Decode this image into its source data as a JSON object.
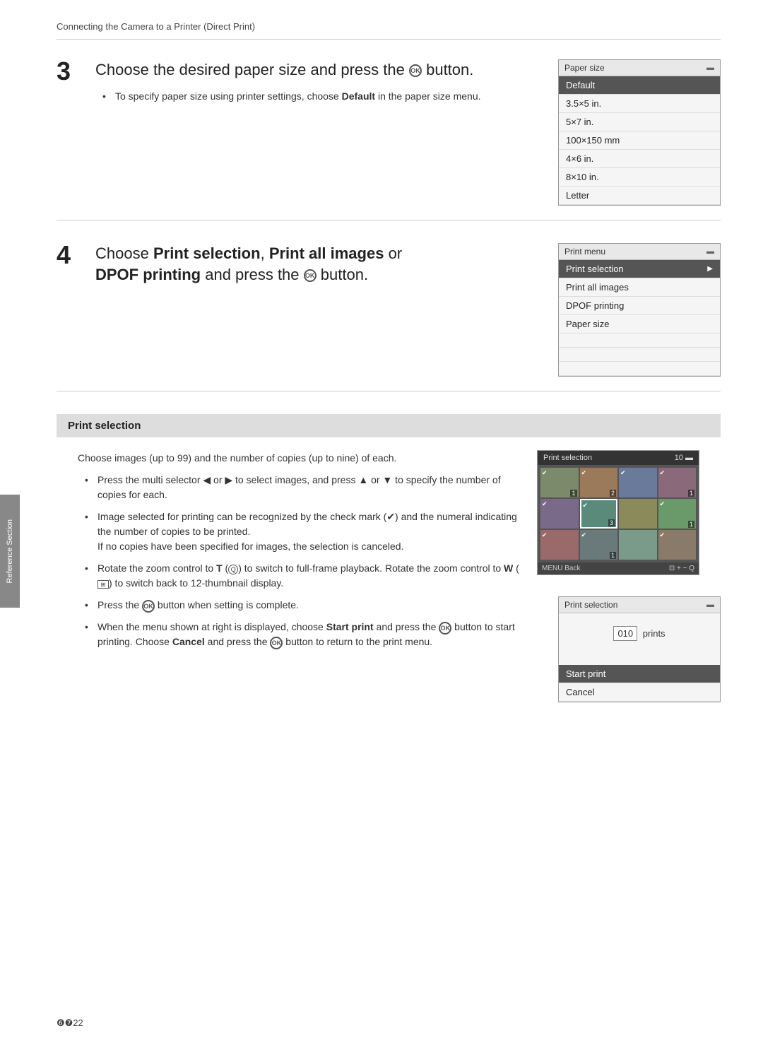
{
  "breadcrumb": "Connecting the Camera to a Printer (Direct Print)",
  "step3": {
    "number": "3",
    "title_part1": "Choose the desired paper size and press the",
    "title_part2": "button.",
    "bullet": "To specify paper size using printer settings, choose",
    "bullet_bold": "Default",
    "bullet_end": "in the paper size menu.",
    "screen": {
      "header": "Paper size",
      "items": [
        "Default",
        "3.5×5 in.",
        "5×7 in.",
        "100×150 mm",
        "4×6 in.",
        "8×10 in.",
        "Letter"
      ]
    }
  },
  "step4": {
    "number": "4",
    "title_part1": "Choose",
    "print_selection": "Print selection",
    "comma": ",",
    "print_all": "Print all images",
    "or": "or",
    "dpof": "DPOF printing",
    "title_part2": "and press the",
    "title_part3": "button.",
    "screen": {
      "header": "Print menu",
      "items": [
        "Print selection",
        "Print all images",
        "DPOF printing",
        "Paper size"
      ]
    }
  },
  "print_selection_section": {
    "header": "Print selection",
    "intro": "Choose images (up to 99) and the number of copies (up to nine) of each.",
    "bullets": [
      "Press the multi selector ◀ or ▶ to select images, and press ▲ or ▼ to specify the number of copies for each.",
      "Image selected for printing can be recognized by the check mark (✔) and the numeral indicating the number of copies to be printed.",
      "If no copies have been specified for images, the selection is canceled.",
      "Rotate the zoom control to T (Q) to switch to full-frame playback. Rotate the zoom control to W (⊡) to switch back to 12-thumbnail display.",
      "Press the OK button when setting is complete.",
      "When the menu shown at right is displayed, choose Start print and press the OK button to start printing. Choose Cancel and press the OK button to return to the print menu."
    ],
    "thumb_screen": {
      "header_left": "Print selection",
      "header_right": "10",
      "footer_left": "MENU Back",
      "footer_right": "⊡ + − Q"
    },
    "print_sel_screen": {
      "header": "Print selection",
      "count_label": "010",
      "count_suffix": "prints",
      "items": [
        "Start print",
        "Cancel"
      ]
    }
  },
  "sidebar": {
    "label": "Reference Section"
  },
  "page_number": "❻❼22"
}
